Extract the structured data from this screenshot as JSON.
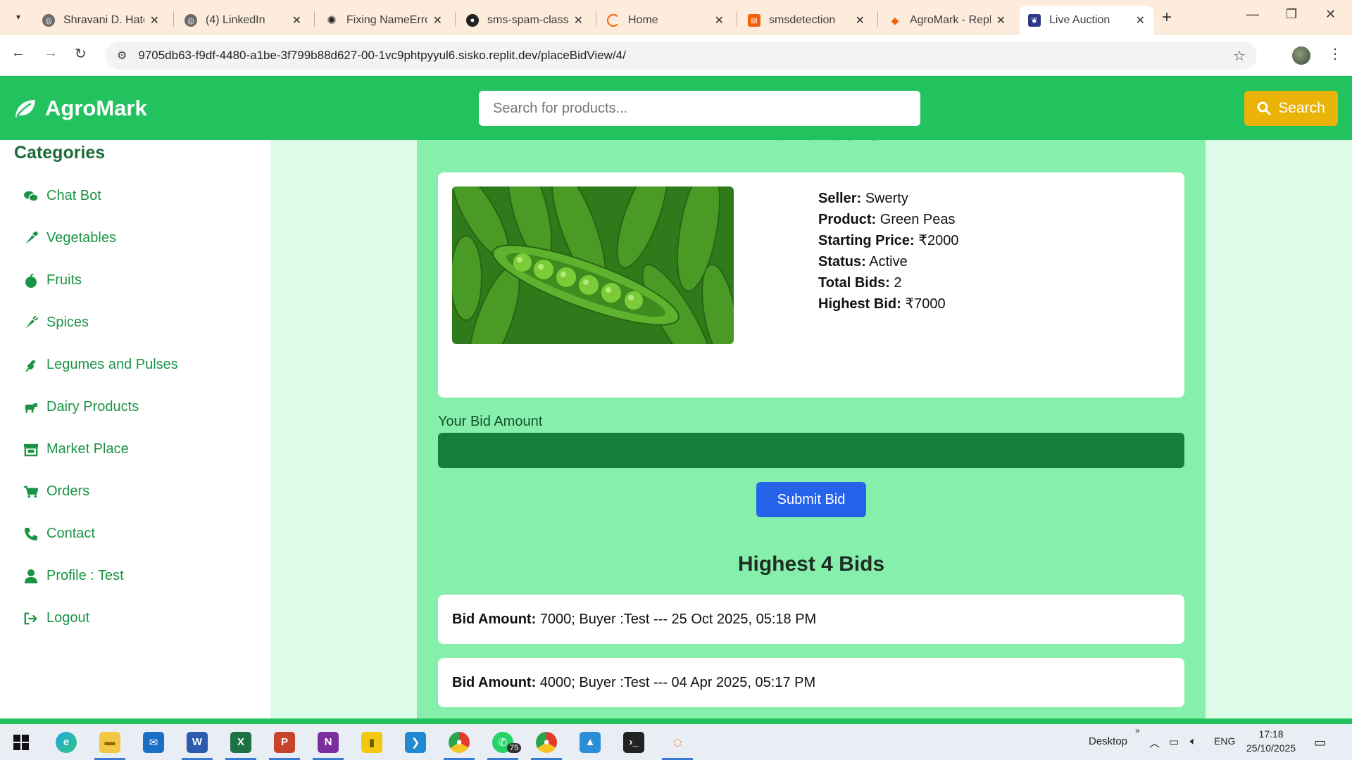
{
  "browser": {
    "tabs": [
      {
        "label": "Shravani D. Hate",
        "fav": "linkedin-icon"
      },
      {
        "label": "(4) LinkedIn",
        "fav": "linkedin-icon"
      },
      {
        "label": "Fixing NameErro",
        "fav": "chatgpt-icon"
      },
      {
        "label": "sms-spam-classi",
        "fav": "github-icon"
      },
      {
        "label": "Home",
        "fav": "loading-icon"
      },
      {
        "label": "smsdetection",
        "fav": "notebook-icon"
      },
      {
        "label": "AgroMark - Repl",
        "fav": "replit-icon"
      },
      {
        "label": "Live Auction",
        "fav": "agromark-icon"
      }
    ],
    "url": "9705db63-f9df-4480-a1be-3f799b88d627-00-1vc9phtpyyul6.sisko.replit.dev/placeBidView/4/"
  },
  "header": {
    "brand": "AgroMark",
    "search_placeholder": "Search for products...",
    "search_button": "Search",
    "brand_color": "#22c35e",
    "search_button_color": "#eab308"
  },
  "sidebar": {
    "title": "Categories",
    "items": [
      {
        "label": "Chat Bot",
        "icon": "comments-icon"
      },
      {
        "label": "Vegetables",
        "icon": "carrot-icon"
      },
      {
        "label": "Fruits",
        "icon": "apple-icon"
      },
      {
        "label": "Spices",
        "icon": "pepper-icon"
      },
      {
        "label": "Legumes and Pulses",
        "icon": "seedling-icon"
      },
      {
        "label": "Dairy Products",
        "icon": "cow-icon"
      },
      {
        "label": "Market Place",
        "icon": "store-icon"
      },
      {
        "label": "Orders",
        "icon": "cart-icon"
      },
      {
        "label": "Contact",
        "icon": "phone-icon"
      },
      {
        "label": "Profile : Test",
        "icon": "user-icon"
      },
      {
        "label": "Logout",
        "icon": "logout-icon"
      }
    ]
  },
  "main": {
    "page_title": "Live Auctions",
    "product": {
      "seller_label": "Seller:",
      "seller": "Swerty",
      "product_label": "Product:",
      "product": "Green Peas",
      "price_label": "Starting Price:",
      "price": "₹2000",
      "status_label": "Status:",
      "status": "Active",
      "bids_label": "Total Bids:",
      "bids": "2",
      "highest_label": "Highest Bid:",
      "highest": "₹7000"
    },
    "bid_label": "Your Bid Amount",
    "submit": "Submit Bid",
    "bids_title": "Highest 4 Bids",
    "bid_rows": [
      {
        "label": "Bid Amount:",
        "text": "7000; Buyer :Test --- 25 Oct 2025, 05:18 PM"
      },
      {
        "label": "Bid Amount:",
        "text": "4000; Buyer :Test --- 04 Apr 2025, 05:17 PM"
      }
    ]
  },
  "taskbar": {
    "desktop_label": "Desktop",
    "lang": "ENG",
    "time": "17:18",
    "date": "25/10/2025",
    "whatsapp_badge": "75"
  }
}
